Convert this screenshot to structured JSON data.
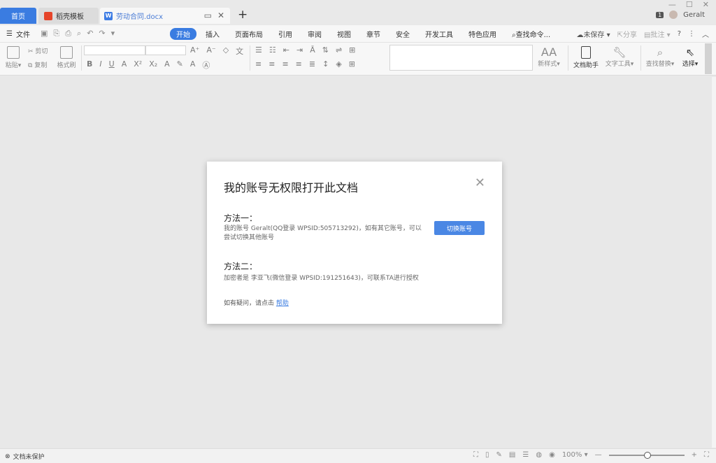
{
  "tabs": {
    "home": "首页",
    "daoke": "稻壳模板",
    "doc": "劳动合同.docx"
  },
  "header": {
    "badge": "1",
    "user": "Geralt"
  },
  "menu": {
    "file": "文件",
    "items": [
      "开始",
      "插入",
      "页面布局",
      "引用",
      "审阅",
      "视图",
      "章节",
      "安全",
      "开发工具",
      "特色应用"
    ],
    "search": "查找命令...",
    "unsaved": "未保存",
    "share": "分享",
    "comment": "批注",
    "help": "?"
  },
  "ribbon": {
    "paste": "粘贴",
    "cut": "剪切",
    "copy": "复制",
    "format_painter": "格式刷",
    "new_style": "新样式",
    "doc_assistant": "文档助手",
    "text_tools": "文字工具",
    "find_replace": "查找替换",
    "select": "选择"
  },
  "dialog": {
    "title": "我的账号无权限打开此文档",
    "method1_title": "方法一：",
    "method1_text": "我的账号 Geralt(QQ登录 WPSID:505713292)，如有其它账号，可以尝试切换其他账号",
    "switch_button": "切换账号",
    "method2_title": "方法二：",
    "method2_text": "加密者是 李亚飞(微信登录 WPSID:191251643)，可联系TA进行授权",
    "help_prefix": "如有疑问，请点击",
    "help_link": "帮助"
  },
  "status": {
    "protect": "文档未保护",
    "zoom": "100%",
    "zoom_level_fraction": 0.5
  }
}
